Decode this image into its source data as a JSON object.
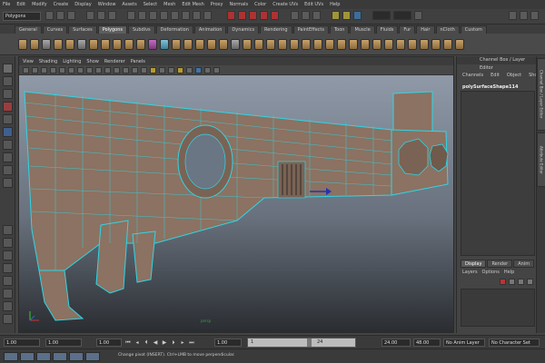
{
  "menu": [
    "File",
    "Edit",
    "Modify",
    "Create",
    "Display",
    "Window",
    "Assets",
    "Select",
    "Mesh",
    "Edit Mesh",
    "Proxy",
    "Normals",
    "Color",
    "Create UVs",
    "Edit UVs",
    "Help"
  ],
  "mode": "Polygons",
  "shelf_tabs": [
    "General",
    "Curves",
    "Surfaces",
    "Polygons",
    "Subdivs",
    "Deformation",
    "Animation",
    "Dynamics",
    "Rendering",
    "PaintEffects",
    "Toon",
    "Muscle",
    "Fluids",
    "Fur",
    "Hair",
    "nCloth",
    "Custom"
  ],
  "active_shelf_tab": "Polygons",
  "viewport_menu": [
    "View",
    "Shading",
    "Lighting",
    "Show",
    "Renderer",
    "Panels"
  ],
  "camera_label": "persp",
  "channel_box": {
    "title": "Channel Box / Layer Editor",
    "menu": [
      "Channels",
      "Edit",
      "Object",
      "Show"
    ],
    "object_name": "polySurfaceShape114"
  },
  "layer_tabs": [
    "Display",
    "Render",
    "Anim"
  ],
  "layer_menu": [
    "Layers",
    "Options",
    "Help"
  ],
  "side_tabs": [
    "Channel Box / Layer Editor",
    "Attribute Editor"
  ],
  "timeline": {
    "start": "1.00",
    "current_start": "1.00",
    "range_start": "1.00",
    "slider_start": "1",
    "slider_end": "24",
    "range_end": "24.00",
    "end": "48.00",
    "anim_layer": "No Anim Layer",
    "char_set": "No Character Set"
  },
  "help_line": "Change pivot (INSERT). Ctrl+LMB to move perpendicular."
}
